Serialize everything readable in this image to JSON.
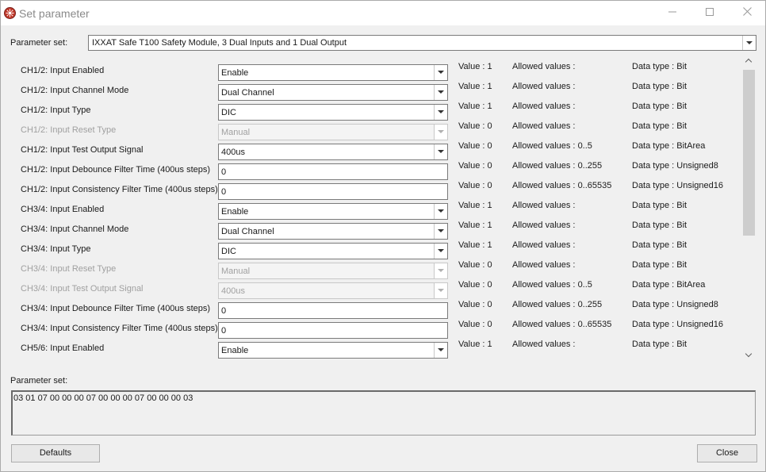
{
  "window": {
    "title": "Set parameter"
  },
  "parameter_set_label": "Parameter set:",
  "parameter_set_value": "IXXAT Safe T100 Safety Module, 3 Dual Inputs and 1 Dual Output",
  "columns": {
    "value_prefix": "Value :",
    "allowed_prefix": "Allowed values :",
    "dtype_prefix": "Data type :"
  },
  "rows": [
    {
      "name": "CH1/2: Input Enabled",
      "control": "combo",
      "current": "Enable",
      "disabled": false,
      "value": "1",
      "allowed": "",
      "dtype": "Bit"
    },
    {
      "name": "CH1/2: Input Channel Mode",
      "control": "combo",
      "current": "Dual Channel",
      "disabled": false,
      "value": "1",
      "allowed": "",
      "dtype": "Bit"
    },
    {
      "name": "CH1/2: Input Type",
      "control": "combo",
      "current": "DIC",
      "disabled": false,
      "value": "1",
      "allowed": "",
      "dtype": "Bit"
    },
    {
      "name": "CH1/2: Input Reset Type",
      "control": "combo",
      "current": "Manual",
      "disabled": true,
      "value": "0",
      "allowed": "",
      "dtype": "Bit"
    },
    {
      "name": "CH1/2: Input Test Output Signal",
      "control": "combo",
      "current": "400us",
      "disabled": false,
      "value": "0",
      "allowed": "0..5",
      "dtype": "BitArea"
    },
    {
      "name": "CH1/2: Input Debounce Filter Time (400us steps)",
      "control": "text",
      "current": "0",
      "disabled": false,
      "value": "0",
      "allowed": "0..255",
      "dtype": "Unsigned8"
    },
    {
      "name": "CH1/2: Input Consistency Filter Time (400us steps)",
      "control": "text",
      "current": "0",
      "disabled": false,
      "value": "0",
      "allowed": "0..65535",
      "dtype": "Unsigned16"
    },
    {
      "name": "CH3/4: Input Enabled",
      "control": "combo",
      "current": "Enable",
      "disabled": false,
      "value": "1",
      "allowed": "",
      "dtype": "Bit"
    },
    {
      "name": "CH3/4: Input Channel Mode",
      "control": "combo",
      "current": "Dual Channel",
      "disabled": false,
      "value": "1",
      "allowed": "",
      "dtype": "Bit"
    },
    {
      "name": "CH3/4: Input Type",
      "control": "combo",
      "current": "DIC",
      "disabled": false,
      "value": "1",
      "allowed": "",
      "dtype": "Bit"
    },
    {
      "name": "CH3/4: Input Reset Type",
      "control": "combo",
      "current": "Manual",
      "disabled": true,
      "value": "0",
      "allowed": "",
      "dtype": "Bit"
    },
    {
      "name": "CH3/4: Input Test Output Signal",
      "control": "combo",
      "current": "400us",
      "disabled": true,
      "value": "0",
      "allowed": "0..5",
      "dtype": "BitArea"
    },
    {
      "name": "CH3/4: Input Debounce Filter Time (400us steps)",
      "control": "text",
      "current": "0",
      "disabled": false,
      "value": "0",
      "allowed": "0..255",
      "dtype": "Unsigned8"
    },
    {
      "name": "CH3/4: Input Consistency Filter Time (400us steps)",
      "control": "text",
      "current": "0",
      "disabled": false,
      "value": "0",
      "allowed": "0..65535",
      "dtype": "Unsigned16"
    },
    {
      "name": "CH5/6: Input Enabled",
      "control": "combo",
      "current": "Enable",
      "disabled": false,
      "value": "1",
      "allowed": "",
      "dtype": "Bit"
    }
  ],
  "bottom_label": "Parameter set:",
  "bytes": "03 01 07 00 00 00 07 00 00 00 07 00 00 00 03",
  "buttons": {
    "defaults": "Defaults",
    "close": "Close"
  },
  "icons": {
    "app": "app-logo-icon",
    "minimize": "minimize-icon",
    "maximize": "maximize-icon",
    "close": "close-icon"
  },
  "colors": {
    "window_bg": "#f0f0f0",
    "titlebar_bg": "#ffffff",
    "disabled_text": "#a0a0a0"
  }
}
